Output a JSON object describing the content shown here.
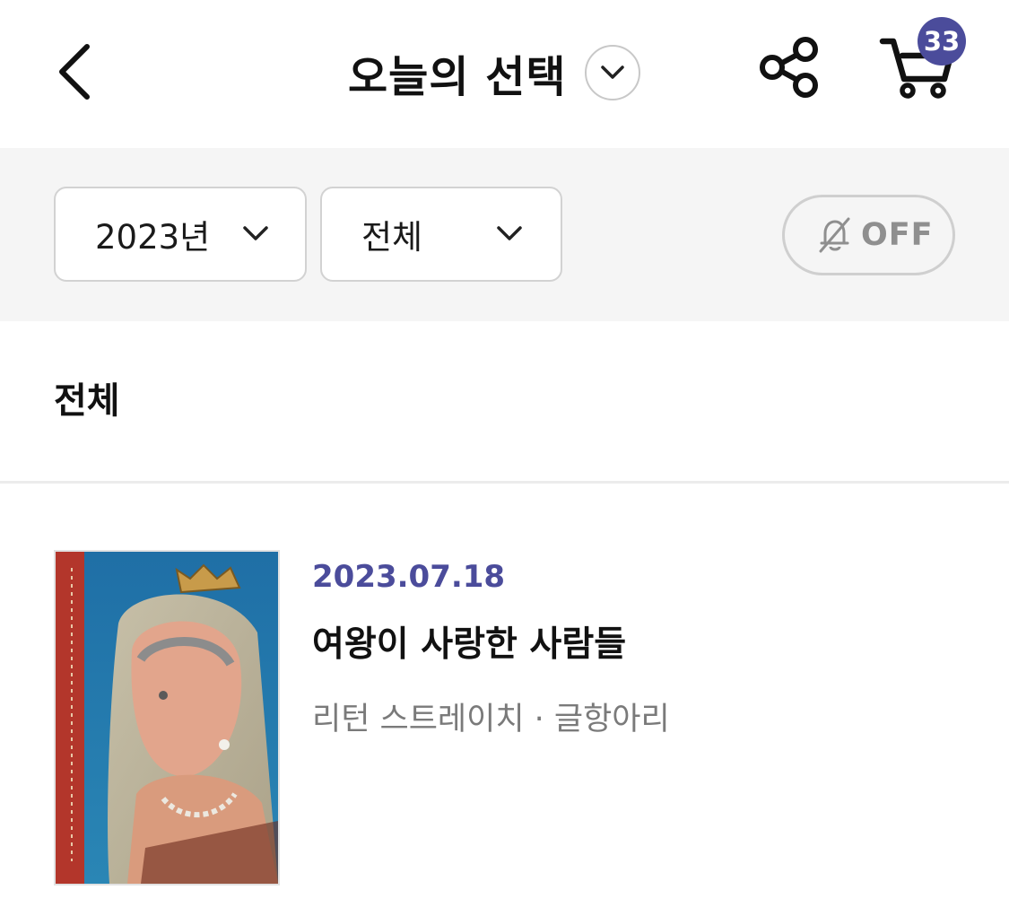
{
  "header": {
    "title": "오늘의 선택",
    "cart_count": "33"
  },
  "filters": {
    "year": "2023년",
    "category": "전체",
    "alarm": "OFF"
  },
  "section": {
    "title": "전체"
  },
  "items": [
    {
      "date": "2023.07.18",
      "title": "여왕이 사랑한 사람들",
      "meta": "리턴 스트레이치 · 글항아리"
    }
  ],
  "colors": {
    "accent": "#4b4c9b",
    "filter_bg": "#f5f5f5",
    "muted_text": "#7a7a7a"
  },
  "icons": [
    "back-icon",
    "chevron-down-icon",
    "share-icon",
    "cart-icon",
    "bell-off-icon"
  ]
}
